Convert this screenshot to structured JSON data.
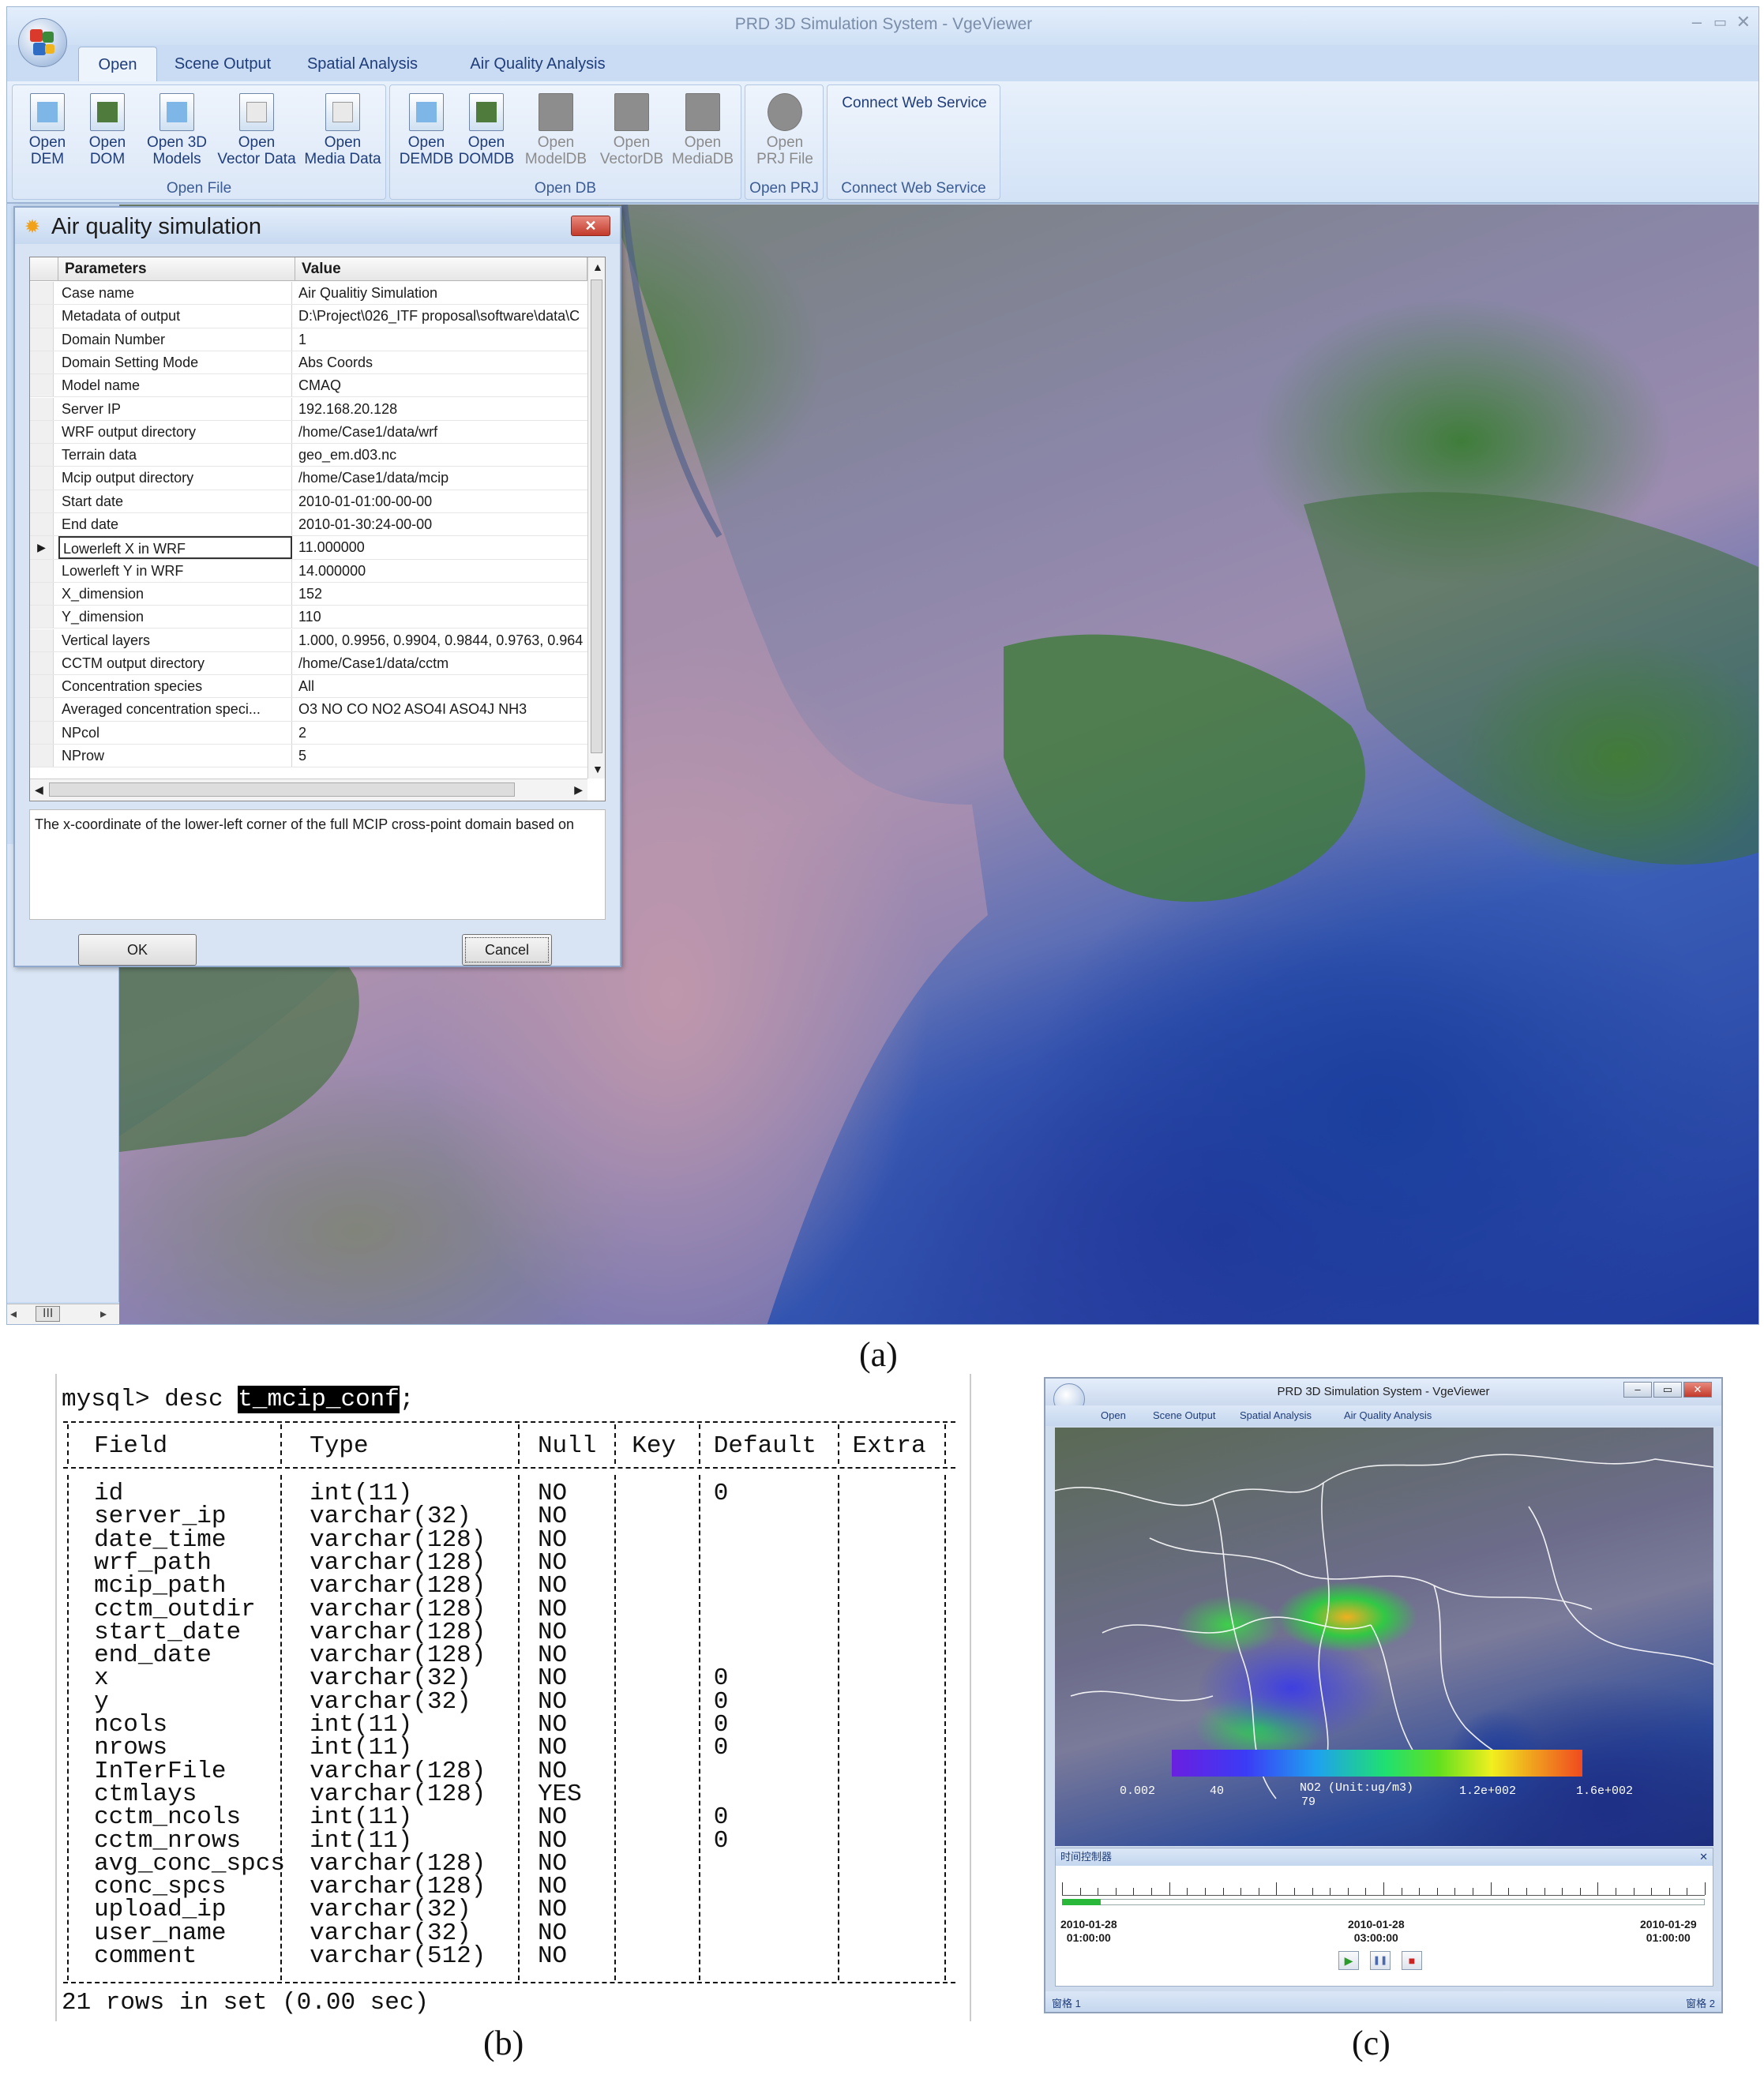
{
  "panel_a": {
    "window_title": "PRD 3D Simulation System - VgeViewer",
    "window_controls": [
      "–",
      "▭",
      "✕"
    ],
    "tabs": [
      "Open",
      "Scene Output",
      "Spatial Analysis",
      "Air Quality Analysis"
    ],
    "ribbon": {
      "open_file": {
        "label": "Open File",
        "buttons": [
          "Open\nDEM",
          "Open\nDOM",
          "Open 3D\nModels",
          "Open\nVector Data",
          "Open\nMedia Data"
        ]
      },
      "open_db": {
        "label": "Open DB",
        "buttons": [
          "Open\nDEMDB",
          "Open\nDOMDB",
          "Open\nModelDB",
          "Open\nVectorDB",
          "Open\nMediaDB"
        ]
      },
      "open_prj": {
        "label": "Open PRJ",
        "button": "Open\nPRJ File"
      },
      "connect": {
        "label": "Connect Web Service",
        "button": "Connect Web Service"
      }
    },
    "dialog": {
      "title": "Air quality simulation",
      "close": "✕",
      "columns": [
        "Parameters",
        "Value"
      ],
      "rows": [
        {
          "p": "Case name",
          "v": "Air Qualitiy Simulation"
        },
        {
          "p": "Metadata of output",
          "v": "D:\\Project\\026_ITF proposal\\software\\data\\C"
        },
        {
          "p": "Domain Number",
          "v": "1"
        },
        {
          "p": "Domain Setting Mode",
          "v": "Abs Coords"
        },
        {
          "p": "Model name",
          "v": "CMAQ"
        },
        {
          "p": "Server IP",
          "v": "192.168.20.128"
        },
        {
          "p": "WRF output directory",
          "v": "/home/Case1/data/wrf"
        },
        {
          "p": "Terrain data",
          "v": "geo_em.d03.nc"
        },
        {
          "p": "Mcip output directory",
          "v": "/home/Case1/data/mcip"
        },
        {
          "p": "Start date",
          "v": "2010-01-01:00-00-00"
        },
        {
          "p": "End date",
          "v": "2010-01-30:24-00-00"
        },
        {
          "p": "Lowerleft X in WRF",
          "v": "11.000000"
        },
        {
          "p": "Lowerleft Y in WRF",
          "v": "14.000000"
        },
        {
          "p": "X_dimension",
          "v": "152"
        },
        {
          "p": "Y_dimension",
          "v": "110"
        },
        {
          "p": "Vertical layers",
          "v": "1.000,  0.9956, 0.9904, 0.9844, 0.9763, 0.964"
        },
        {
          "p": "CCTM output directory",
          "v": "/home/Case1/data/cctm"
        },
        {
          "p": "Concentration species",
          "v": "All"
        },
        {
          "p": "Averaged concentration speci...",
          "v": "O3 NO CO NO2 ASO4I ASO4J NH3"
        },
        {
          "p": "NPcol",
          "v": "2"
        },
        {
          "p": "NProw",
          "v": "5"
        }
      ],
      "current_row_marker": "▶",
      "description": "The x-coordinate of the lower-left corner of the full MCIP cross-point domain based on",
      "ok": "OK",
      "cancel": "Cancel"
    },
    "scrollbar_thumb": "III",
    "caption": "(a)"
  },
  "panel_b": {
    "prompt": "mysql> desc ",
    "table_name": "t_mcip_conf",
    "prompt_end": ";",
    "headers": [
      "Field",
      "Type",
      "Null",
      "Key",
      "Default",
      "Extra"
    ],
    "rows": [
      [
        "id",
        "int(11)",
        "NO",
        "",
        "0",
        ""
      ],
      [
        "server_ip",
        "varchar(32)",
        "NO",
        "",
        "",
        ""
      ],
      [
        "date_time",
        "varchar(128)",
        "NO",
        "",
        "",
        ""
      ],
      [
        "wrf_path",
        "varchar(128)",
        "NO",
        "",
        "",
        ""
      ],
      [
        "mcip_path",
        "varchar(128)",
        "NO",
        "",
        "",
        ""
      ],
      [
        "cctm_outdir",
        "varchar(128)",
        "NO",
        "",
        "",
        ""
      ],
      [
        "start_date",
        "varchar(128)",
        "NO",
        "",
        "",
        ""
      ],
      [
        "end_date",
        "varchar(128)",
        "NO",
        "",
        "",
        ""
      ],
      [
        "x",
        "varchar(32)",
        "NO",
        "",
        "0",
        ""
      ],
      [
        "y",
        "varchar(32)",
        "NO",
        "",
        "0",
        ""
      ],
      [
        "ncols",
        "int(11)",
        "NO",
        "",
        "0",
        ""
      ],
      [
        "nrows",
        "int(11)",
        "NO",
        "",
        "0",
        ""
      ],
      [
        "InTerFile",
        "varchar(128)",
        "NO",
        "",
        "",
        ""
      ],
      [
        "ctmlays",
        "varchar(128)",
        "YES",
        "",
        "",
        ""
      ],
      [
        "cctm_ncols",
        "int(11)",
        "NO",
        "",
        "0",
        ""
      ],
      [
        "cctm_nrows",
        "int(11)",
        "NO",
        "",
        "0",
        ""
      ],
      [
        "avg_conc_spcs",
        "varchar(128)",
        "NO",
        "",
        "",
        ""
      ],
      [
        "conc_spcs",
        "varchar(128)",
        "NO",
        "",
        "",
        ""
      ],
      [
        "upload_ip",
        "varchar(32)",
        "NO",
        "",
        "",
        ""
      ],
      [
        "user_name",
        "varchar(32)",
        "NO",
        "",
        "",
        ""
      ],
      [
        "comment",
        "varchar(512)",
        "NO",
        "",
        "",
        ""
      ]
    ],
    "footer": "21 rows in set (0.00 sec)",
    "caption": "(b)"
  },
  "panel_c": {
    "window_title": "PRD 3D Simulation System - VgeViewer",
    "tabs": [
      "Open",
      "Scene Output",
      "Spatial Analysis",
      "Air Quality Analysis"
    ],
    "legend": {
      "title": "NO2 (Unit:ug/m3)",
      "ticks": [
        "0.002",
        "40",
        "79",
        "1.2e+002",
        "1.6e+002"
      ]
    },
    "timeline": {
      "title": "时间控制器",
      "close": "✕",
      "start": "2010-01-28\n01:00:00",
      "mid": "2010-01-28\n03:00:00",
      "end": "2010-01-29\n01:00:00",
      "progress": 0.06,
      "play": "▶",
      "pause": "❚❚",
      "stop": "■"
    },
    "status_left": "窗格 1",
    "status_right": "窗格 2",
    "caption": "(c)"
  }
}
